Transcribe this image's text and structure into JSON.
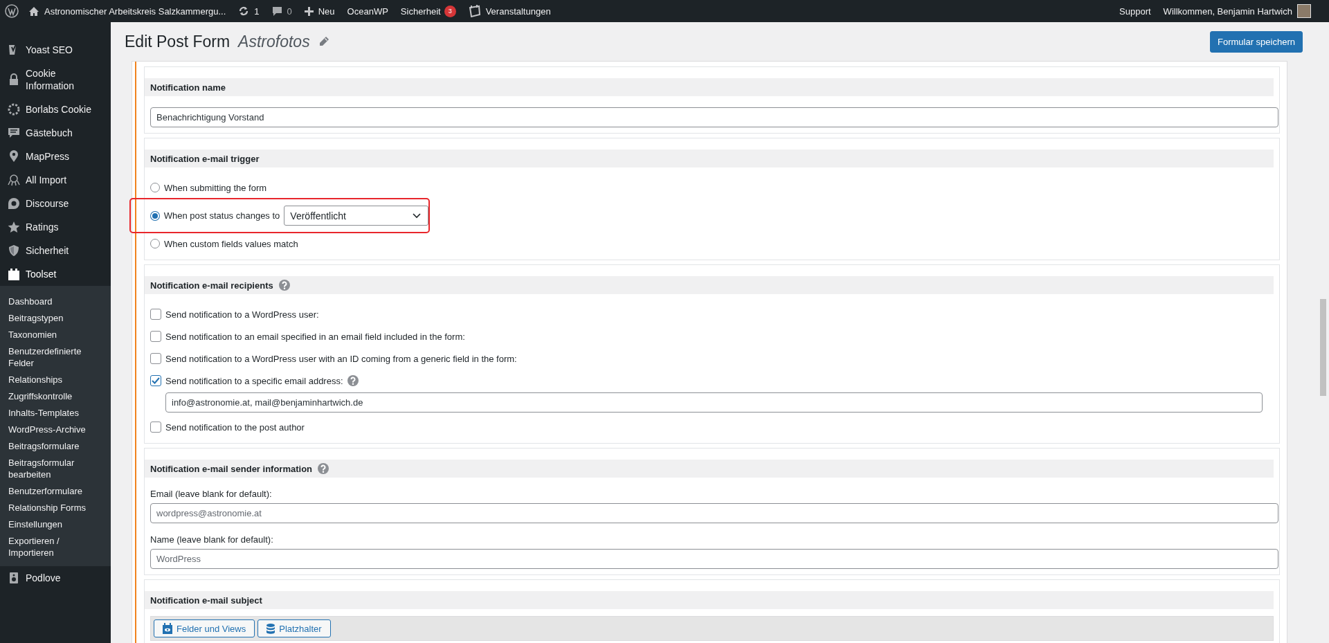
{
  "admin_bar": {
    "site_name": "Astronomischer Arbeitskreis Salzkammergu...",
    "updates": "1",
    "comments": "0",
    "new_label": "Neu",
    "theme": "OceanWP",
    "security": {
      "label": "Sicherheit",
      "badge": "3"
    },
    "events": "Veranstaltungen",
    "support": "Support",
    "greeting": "Willkommen, Benjamin Hartwich"
  },
  "sidebar": {
    "items": [
      {
        "label": "Yoast SEO",
        "selected": false
      },
      {
        "label": "Cookie Information",
        "selected": false
      },
      {
        "label": "Borlabs Cookie",
        "selected": false
      },
      {
        "label": "Gästebuch",
        "selected": false
      },
      {
        "label": "MapPress",
        "selected": false
      },
      {
        "label": "All Import",
        "selected": false
      },
      {
        "label": "Discourse",
        "selected": false
      },
      {
        "label": "Ratings",
        "selected": false
      },
      {
        "label": "Sicherheit",
        "selected": false
      },
      {
        "label": "Toolset",
        "selected": true,
        "children": [
          "Dashboard",
          "Beitragstypen",
          "Taxonomien",
          "Benutzerdefinierte Felder",
          "Relationships",
          "Zugriffskontrolle",
          "Inhalts-Templates",
          "WordPress-Archive",
          "Beitragsformulare",
          "Beitragsformular bearbeiten",
          "Benutzerformulare",
          "Relationship Forms",
          "Einstellungen",
          "Exportieren / Importieren"
        ]
      },
      {
        "label": "Podlove",
        "selected": false
      }
    ]
  },
  "page": {
    "title": "Edit Post Form",
    "post_title": "Astrofotos",
    "save_button": "Formular speichern"
  },
  "sections": [
    {
      "kind": "text",
      "heading": "Notification name",
      "help": false,
      "value": "Benachrichtigung Vorstand"
    },
    {
      "kind": "radios",
      "heading": "Notification e-mail trigger",
      "help": false,
      "options": [
        {
          "label": "When submitting the form",
          "selected": false,
          "highlighted": false
        },
        {
          "label": "When post status changes to",
          "selected": true,
          "highlighted": true,
          "select": "Veröffentlicht"
        },
        {
          "label": "When custom fields values match",
          "selected": false,
          "highlighted": false
        }
      ]
    },
    {
      "kind": "checkboxes",
      "heading": "Notification e-mail recipients",
      "help": true,
      "options": [
        {
          "label": "Send notification to a WordPress user:",
          "checked": false
        },
        {
          "label": "Send notification to an email specified in an email field included in the form:",
          "checked": false
        },
        {
          "label": "Send notification to a WordPress user with an ID coming from a generic field in the form:",
          "checked": false
        },
        {
          "label": "Send notification to a specific email address:",
          "checked": true,
          "help": true,
          "value": "info@astronomie.at, mail@benjaminhartwich.de"
        },
        {
          "label": "Send notification to the post author",
          "checked": false
        }
      ]
    },
    {
      "kind": "fields",
      "heading": "Notification e-mail sender information",
      "help": true,
      "fields": [
        {
          "label": "Email (leave blank for default):",
          "placeholder": "wordpress@astronomie.at"
        },
        {
          "label": "Name (leave blank for default):",
          "placeholder": "WordPress"
        }
      ]
    },
    {
      "kind": "editor",
      "heading": "Notification e-mail subject",
      "help": false,
      "buttons": [
        "Felder und Views",
        "Platzhalter"
      ]
    }
  ]
}
